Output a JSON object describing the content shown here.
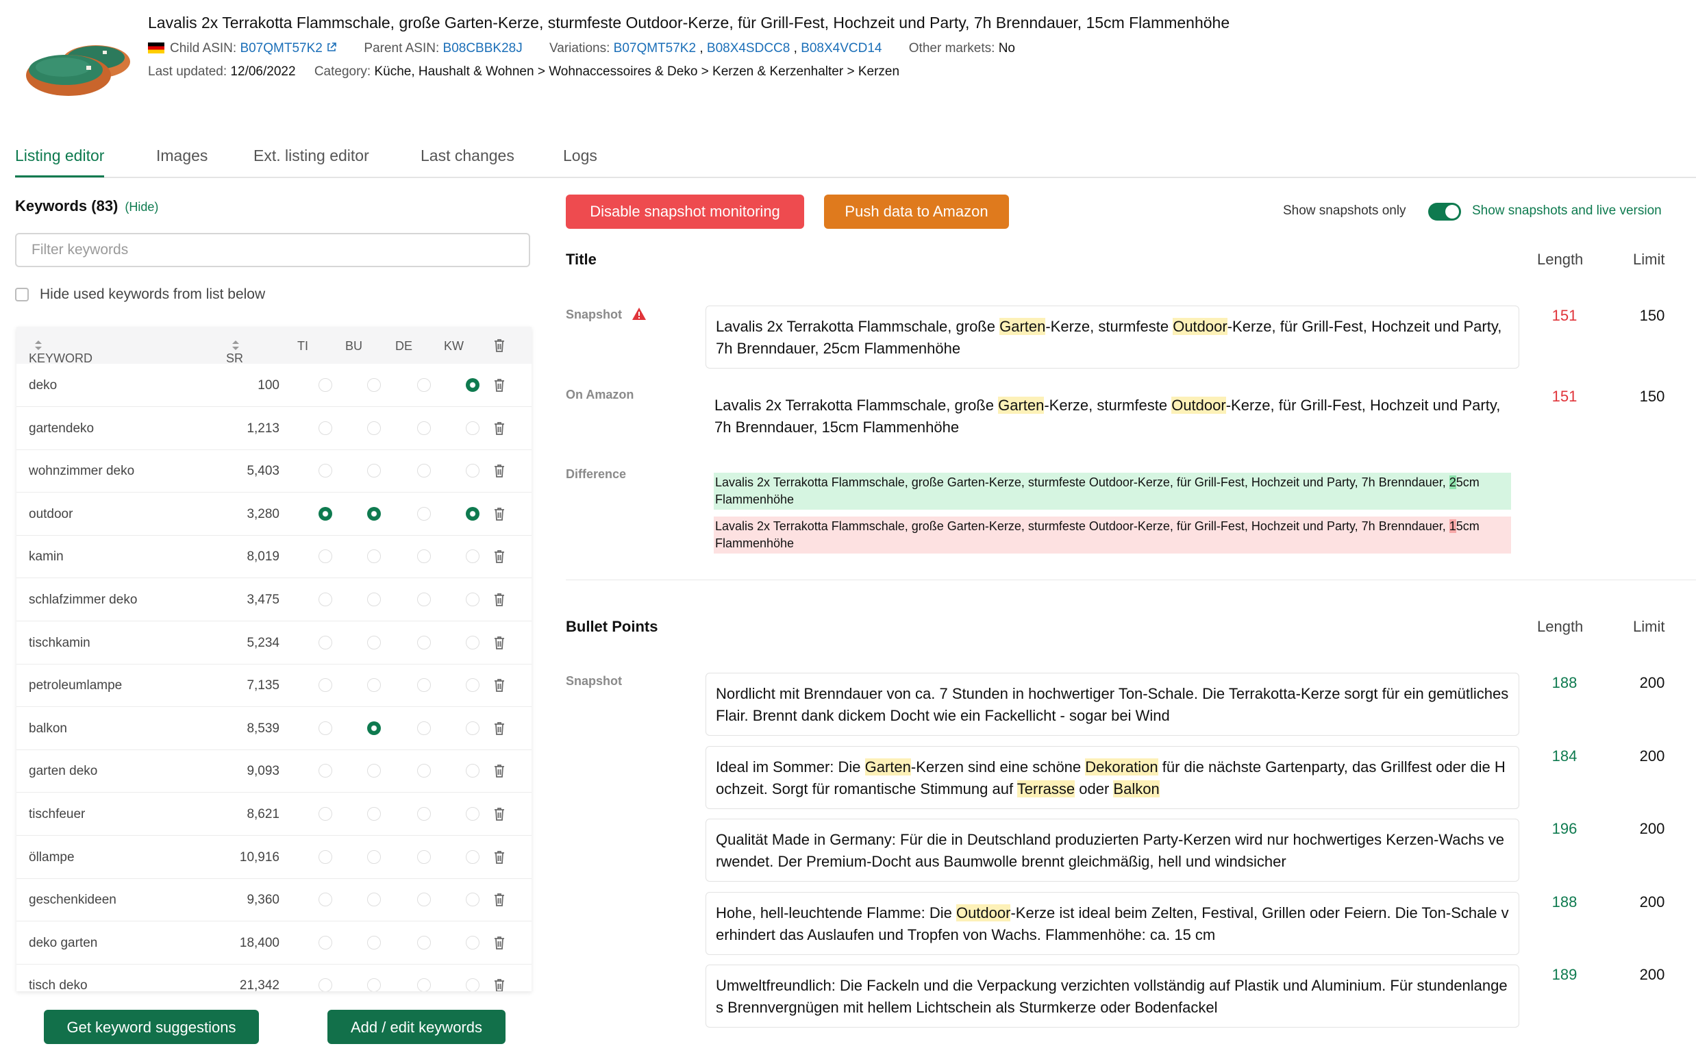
{
  "product": {
    "title": "Lavalis 2x Terrakotta Flammschale, große Garten-Kerze, sturmfeste Outdoor-Kerze, für Grill-Fest, Hochzeit und Party, 7h Brenndauer, 15cm Flammenhöhe",
    "child_asin_label": "Child ASIN:",
    "child_asin": "B07QMT57K2",
    "parent_asin_label": "Parent ASIN:",
    "parent_asin": "B08CBBK28J",
    "variations_label": "Variations:",
    "variations": [
      "B07QMT57K2",
      "B08X4SDCC8",
      "B08X4VCD14"
    ],
    "other_markets_label": "Other markets:",
    "other_markets": "No",
    "last_updated_label": "Last updated:",
    "last_updated": "12/06/2022",
    "category_label": "Category:",
    "category": "Küche, Haushalt & Wohnen > Wohnaccessoires & Deko > Kerzen & Kerzenhalter > Kerzen"
  },
  "tabs": [
    "Listing editor",
    "Images",
    "Ext. listing editor",
    "Last changes",
    "Logs"
  ],
  "keywords": {
    "heading": "Keywords (83)",
    "hide_link": "(Hide)",
    "filter_placeholder": "Filter keywords",
    "hide_used_label": "Hide used keywords from list below",
    "columns": {
      "keyword": "KEYWORD",
      "sr": "SR",
      "ti": "TI",
      "bu": "BU",
      "de": "DE",
      "kw": "KW"
    },
    "rows": [
      {
        "keyword": "deko",
        "sr": "100",
        "ti": false,
        "bu": false,
        "de": false,
        "kw": true
      },
      {
        "keyword": "gartendeko",
        "sr": "1,213",
        "ti": false,
        "bu": false,
        "de": false,
        "kw": false
      },
      {
        "keyword": "wohnzimmer deko",
        "sr": "5,403",
        "ti": false,
        "bu": false,
        "de": false,
        "kw": false
      },
      {
        "keyword": "outdoor",
        "sr": "3,280",
        "ti": true,
        "bu": true,
        "de": false,
        "kw": true
      },
      {
        "keyword": "kamin",
        "sr": "8,019",
        "ti": false,
        "bu": false,
        "de": false,
        "kw": false
      },
      {
        "keyword": "schlafzimmer deko",
        "sr": "3,475",
        "ti": false,
        "bu": false,
        "de": false,
        "kw": false
      },
      {
        "keyword": "tischkamin",
        "sr": "5,234",
        "ti": false,
        "bu": false,
        "de": false,
        "kw": false
      },
      {
        "keyword": "petroleumlampe",
        "sr": "7,135",
        "ti": false,
        "bu": false,
        "de": false,
        "kw": false
      },
      {
        "keyword": "balkon",
        "sr": "8,539",
        "ti": false,
        "bu": true,
        "de": false,
        "kw": false
      },
      {
        "keyword": "garten deko",
        "sr": "9,093",
        "ti": false,
        "bu": false,
        "de": false,
        "kw": false
      },
      {
        "keyword": "tischfeuer",
        "sr": "8,621",
        "ti": false,
        "bu": false,
        "de": false,
        "kw": false
      },
      {
        "keyword": "öllampe",
        "sr": "10,916",
        "ti": false,
        "bu": false,
        "de": false,
        "kw": false
      },
      {
        "keyword": "geschenkideen",
        "sr": "9,360",
        "ti": false,
        "bu": false,
        "de": false,
        "kw": false
      },
      {
        "keyword": "deko garten",
        "sr": "18,400",
        "ti": false,
        "bu": false,
        "de": false,
        "kw": false
      },
      {
        "keyword": "tisch deko",
        "sr": "21,342",
        "ti": false,
        "bu": false,
        "de": false,
        "kw": false
      }
    ],
    "suggest_button": "Get keyword suggestions",
    "edit_button": "Add / edit keywords"
  },
  "toolbar": {
    "disable_button": "Disable snapshot monitoring",
    "push_button": "Push data to Amazon",
    "toggle_left": "Show snapshots only",
    "toggle_right": "Show snapshots and live version"
  },
  "title_section": {
    "heading": "Title",
    "length_header": "Length",
    "limit_header": "Limit",
    "snapshot_label": "Snapshot",
    "on_amazon_label": "On Amazon",
    "difference_label": "Difference",
    "snapshot_parts": [
      "Lavalis 2x Terrakotta Flammschale, große ",
      "Garten",
      "-Kerze, sturmfeste ",
      "Outdoor",
      "-Kerze, für Grill-Fest, Hochzeit und Party, 7h Brenndauer, 25cm Flammenhöhe"
    ],
    "snapshot_length": "151",
    "snapshot_limit": "150",
    "amazon_parts": [
      "Lavalis 2x Terrakotta Flammschale, große ",
      "Garten",
      "-Kerze, sturmfeste ",
      "Outdoor",
      "-Kerze, für Grill-Fest, Hochzeit und Party, 7h Brenndauer, 15cm Flammenhöhe"
    ],
    "amazon_length": "151",
    "amazon_limit": "150",
    "diff_add": [
      "Lavalis 2x Terrakotta Flammschale, große Garten-Kerze, sturmfeste Outdoor-Kerze, für Grill-Fest, Hochzeit und Party, 7h Brenndauer, ",
      "2",
      "5cm Flammenhöhe"
    ],
    "diff_del": [
      "Lavalis 2x Terrakotta Flammschale, große Garten-Kerze, sturmfeste Outdoor-Kerze, für Grill-Fest, Hochzeit und Party, 7h Brenndauer, ",
      "1",
      "5cm Flammenhöhe"
    ]
  },
  "bullets_section": {
    "heading": "Bullet Points",
    "length_header": "Length",
    "limit_header": "Limit",
    "snapshot_label": "Snapshot",
    "bullets": [
      {
        "parts": [
          "Nordlicht mit Brenndauer von ca. 7 Stunden in hochwertiger Ton-Schale. Die Terrakotta-Kerze sorgt für ein gemütliches Flair. Brennt dank dickem Docht wie ein Fackellicht - sogar bei Wind"
        ],
        "length": "188",
        "limit": "200"
      },
      {
        "parts": [
          "Ideal im Sommer: Die ",
          "Garten",
          "-Kerzen sind eine schöne ",
          "Dekoration",
          " für die nächste Gartenparty, das Grillfest oder die Hochzeit. Sorgt für romantische Stimmung auf ",
          "Terrasse",
          " oder ",
          "Balkon"
        ],
        "length": "184",
        "limit": "200"
      },
      {
        "parts": [
          "Qualität Made in Germany: Für die in Deutschland produzierten Party-Kerzen wird nur hochwertiges Kerzen-Wachs verwendet. Der Premium-Docht aus Baumwolle brennt gleichmäßig, hell und windsicher"
        ],
        "length": "196",
        "limit": "200"
      },
      {
        "parts": [
          "Hohe, hell-leuchtende Flamme: Die ",
          "Outdoor",
          "-Kerze ist ideal beim Zelten, Festival, Grillen oder Feiern. Die Ton-Schale verhindert das Auslaufen und Tropfen von Wachs. Flammenhöhe: ca. 15 cm"
        ],
        "length": "188",
        "limit": "200"
      },
      {
        "parts": [
          "Umweltfreundlich: Die Fackeln und die Verpackung verzichten vollständig auf Plastik und Aluminium. Für stundenlanges Brennvergnügen mit hellem Lichtschein als Sturmkerze oder Bodenfackel"
        ],
        "length": "189",
        "limit": "200"
      }
    ]
  },
  "colors": {
    "accent": "#0e7a4f",
    "danger": "#ee4b4f",
    "warning": "#df7a1d",
    "link": "#1b6fb8",
    "highlight": "#fdf1b8"
  }
}
